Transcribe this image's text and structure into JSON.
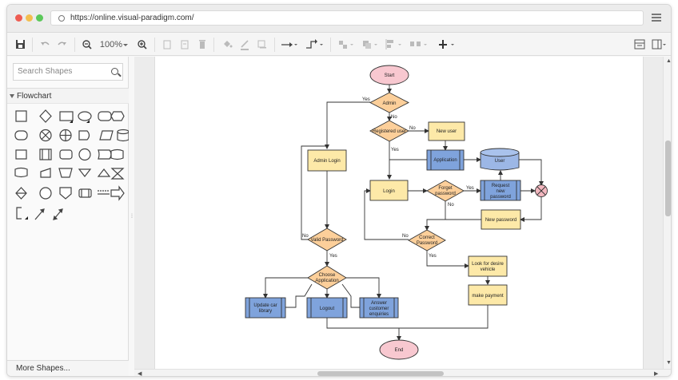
{
  "browser": {
    "url": "https://online.visual-paradigm.com/"
  },
  "toolbar": {
    "zoom": "100%"
  },
  "sidebar": {
    "search_placeholder": "Search Shapes",
    "section_title": "Flowchart",
    "more_shapes": "More Shapes..."
  },
  "colors": {
    "terminal_fill": "#f8c8d0",
    "process_fill": "#fde9a8",
    "decision_fill": "#fccf9a",
    "predefined_fill": "#7fa3dc",
    "stroke": "#333333"
  },
  "diagram": {
    "nodes": {
      "start": "Start",
      "admin": "Admin",
      "registered_user": "Registered user",
      "new_user": "New user",
      "admin_login": "Admin Login",
      "application": "Application",
      "user_db": "User",
      "login": "Login",
      "forget_password": [
        "Forget",
        "password"
      ],
      "request_new_password": [
        "Request",
        "new",
        "password"
      ],
      "new_password": "New password",
      "valid_password": "Valid Password",
      "correct_password": [
        "Correct",
        "Password"
      ],
      "look_for_vehicle": [
        "Look for desire",
        "vehicle"
      ],
      "choose_application": [
        "Choose",
        "Application"
      ],
      "make_payment": "make payment",
      "update_car_library": [
        "Update car",
        "library"
      ],
      "logout": "Logout",
      "answer_customer": [
        "Answer",
        "customer",
        "enquiries"
      ],
      "end": "End"
    },
    "edge_labels": {
      "admin_yes": "Yes",
      "admin_no": "No",
      "registered_no": "No",
      "registered_yes": "Yes",
      "forget_yes": "Yes",
      "forget_no": "No",
      "valid_no": "No",
      "valid_yes": "Yes",
      "correct_no": "No",
      "correct_yes": "Yes"
    }
  }
}
